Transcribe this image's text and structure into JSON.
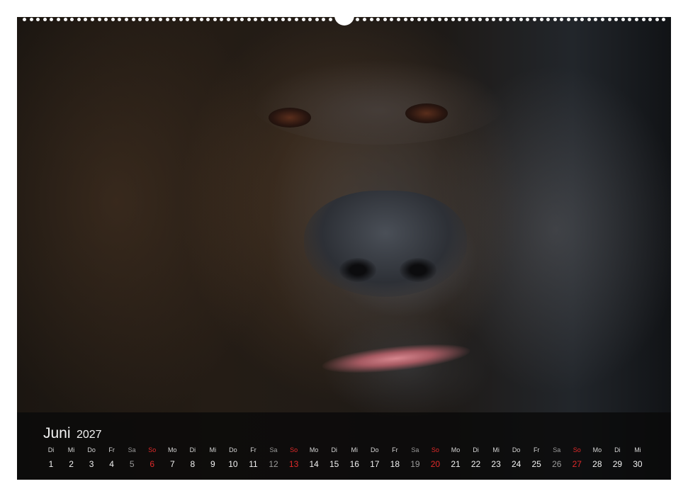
{
  "calendar": {
    "month": "Juni",
    "year": "2027",
    "days": [
      {
        "dow": "Di",
        "num": "1",
        "kind": "weekday"
      },
      {
        "dow": "Mi",
        "num": "2",
        "kind": "weekday"
      },
      {
        "dow": "Do",
        "num": "3",
        "kind": "weekday"
      },
      {
        "dow": "Fr",
        "num": "4",
        "kind": "weekday"
      },
      {
        "dow": "Sa",
        "num": "5",
        "kind": "sat"
      },
      {
        "dow": "So",
        "num": "6",
        "kind": "sun"
      },
      {
        "dow": "Mo",
        "num": "7",
        "kind": "weekday"
      },
      {
        "dow": "Di",
        "num": "8",
        "kind": "weekday"
      },
      {
        "dow": "Mi",
        "num": "9",
        "kind": "weekday"
      },
      {
        "dow": "Do",
        "num": "10",
        "kind": "weekday"
      },
      {
        "dow": "Fr",
        "num": "11",
        "kind": "weekday"
      },
      {
        "dow": "Sa",
        "num": "12",
        "kind": "sat"
      },
      {
        "dow": "So",
        "num": "13",
        "kind": "sun"
      },
      {
        "dow": "Mo",
        "num": "14",
        "kind": "weekday"
      },
      {
        "dow": "Di",
        "num": "15",
        "kind": "weekday"
      },
      {
        "dow": "Mi",
        "num": "16",
        "kind": "weekday"
      },
      {
        "dow": "Do",
        "num": "17",
        "kind": "weekday"
      },
      {
        "dow": "Fr",
        "num": "18",
        "kind": "weekday"
      },
      {
        "dow": "Sa",
        "num": "19",
        "kind": "sat"
      },
      {
        "dow": "So",
        "num": "20",
        "kind": "sun"
      },
      {
        "dow": "Mo",
        "num": "21",
        "kind": "weekday"
      },
      {
        "dow": "Di",
        "num": "22",
        "kind": "weekday"
      },
      {
        "dow": "Mi",
        "num": "23",
        "kind": "weekday"
      },
      {
        "dow": "Do",
        "num": "24",
        "kind": "weekday"
      },
      {
        "dow": "Fr",
        "num": "25",
        "kind": "weekday"
      },
      {
        "dow": "Sa",
        "num": "26",
        "kind": "sat"
      },
      {
        "dow": "So",
        "num": "27",
        "kind": "sun"
      },
      {
        "dow": "Mo",
        "num": "28",
        "kind": "weekday"
      },
      {
        "dow": "Di",
        "num": "29",
        "kind": "weekday"
      },
      {
        "dow": "Mi",
        "num": "30",
        "kind": "weekday"
      }
    ]
  },
  "colors": {
    "sunday": "#e02a2a",
    "saturday": "#9a9a9a",
    "text": "#f2f2f2",
    "strip": "#0a0a0a"
  },
  "photo": {
    "subject_icon": "gorilla-portrait"
  }
}
